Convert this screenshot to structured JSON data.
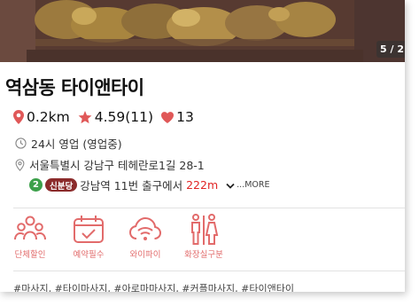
{
  "gallery": {
    "counter": "5 / 2"
  },
  "shop": {
    "name": "역삼동 타이앤타이",
    "distance": "0.2km",
    "rating": "4.59(11)",
    "likes": "13",
    "hours": "24시 영업 (영업중)",
    "address": "서울특별시 강남구 테헤란로1길 28-1",
    "subway": {
      "line": "2",
      "station": "신분당",
      "text": "강남역 11번 출구에서",
      "distance": "222m",
      "more": "MORE"
    }
  },
  "amenities": [
    {
      "label": "단체할인",
      "icon": "group-icon"
    },
    {
      "label": "예약필수",
      "icon": "calendar-check-icon"
    },
    {
      "label": "와이파이",
      "icon": "wifi-cloud-icon"
    },
    {
      "label": "화장실구분",
      "icon": "restroom-icon"
    }
  ],
  "tags": "#마사지, #타이마사지, #아로마마사지, #커플마사지, #타이앤타이",
  "colors": {
    "accent": "#e05858",
    "distance": "#e12525",
    "line2": "#3ca04a",
    "badge": "#8b2b2b"
  }
}
